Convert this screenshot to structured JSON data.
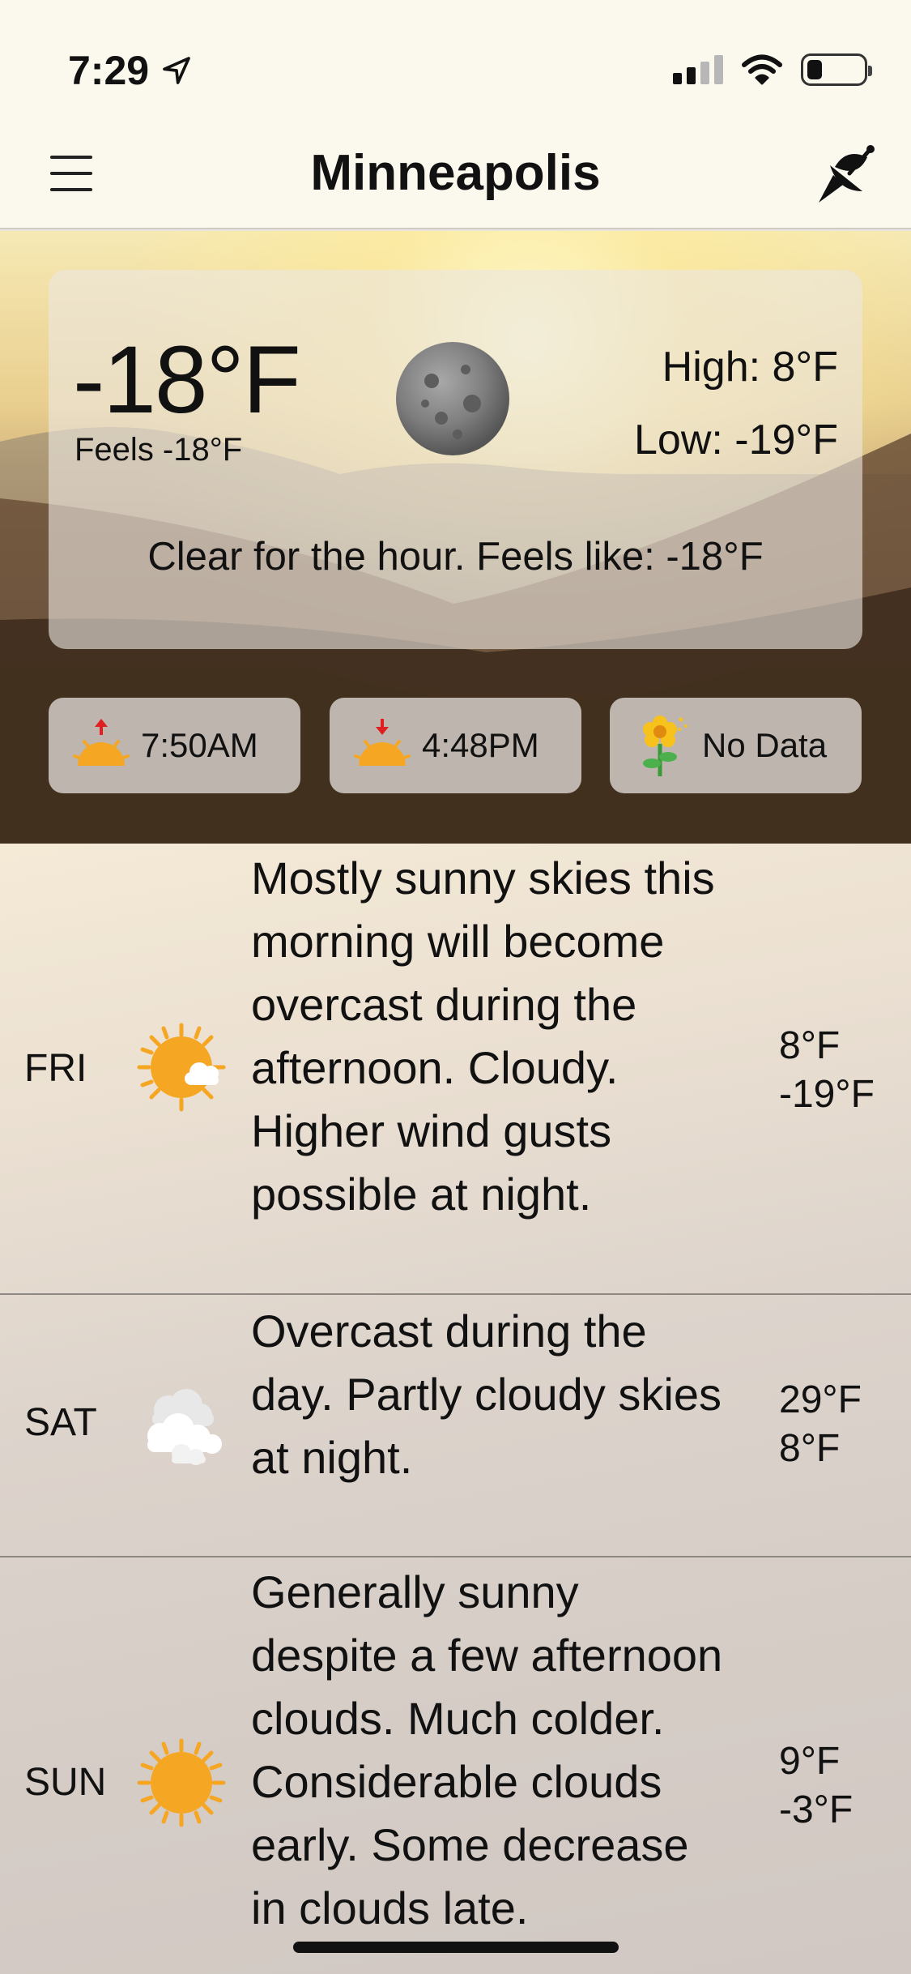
{
  "status_bar": {
    "time": "7:29",
    "location_icon": "location-arrow-icon",
    "signal_bars_active": 2,
    "signal_bars_total": 4,
    "battery_level": 0.2
  },
  "nav": {
    "title": "Minneapolis",
    "menu_icon": "hamburger-icon",
    "radar_icon": "satellite-dish-icon"
  },
  "current": {
    "temp": "-18°F",
    "feels": "Feels -18°F",
    "high": "High: 8°F",
    "low": "Low: -19°F",
    "icon": "moon-icon",
    "summary": "Clear for the hour. Feels like: -18°F"
  },
  "pills": [
    {
      "icon": "sunrise-icon",
      "label": "7:50AM"
    },
    {
      "icon": "sunset-icon",
      "label": "4:48PM"
    },
    {
      "icon": "flower-pollen-icon",
      "label": "No Data"
    }
  ],
  "forecast": [
    {
      "day": "FRI",
      "icon": "sun-cloud-icon",
      "description": "Mostly sunny skies this morning will become overcast during the afternoon. Cloudy.  Higher wind gusts possible at night.",
      "high": "8°F",
      "low": "-19°F"
    },
    {
      "day": "SAT",
      "icon": "cloudy-icon",
      "description": "Overcast during the day. Partly cloudy skies at night.",
      "high": "29°F",
      "low": "8°F"
    },
    {
      "day": "SUN",
      "icon": "sun-icon",
      "description": "Generally sunny despite a few afternoon clouds. Much colder. Considerable clouds early. Some decrease in clouds late.",
      "high": "9°F",
      "low": "-3°F"
    }
  ],
  "colors": {
    "accent_sun": "#f5a623",
    "nav_bg": "#fbf8ee",
    "arrow_red": "#e02020"
  }
}
